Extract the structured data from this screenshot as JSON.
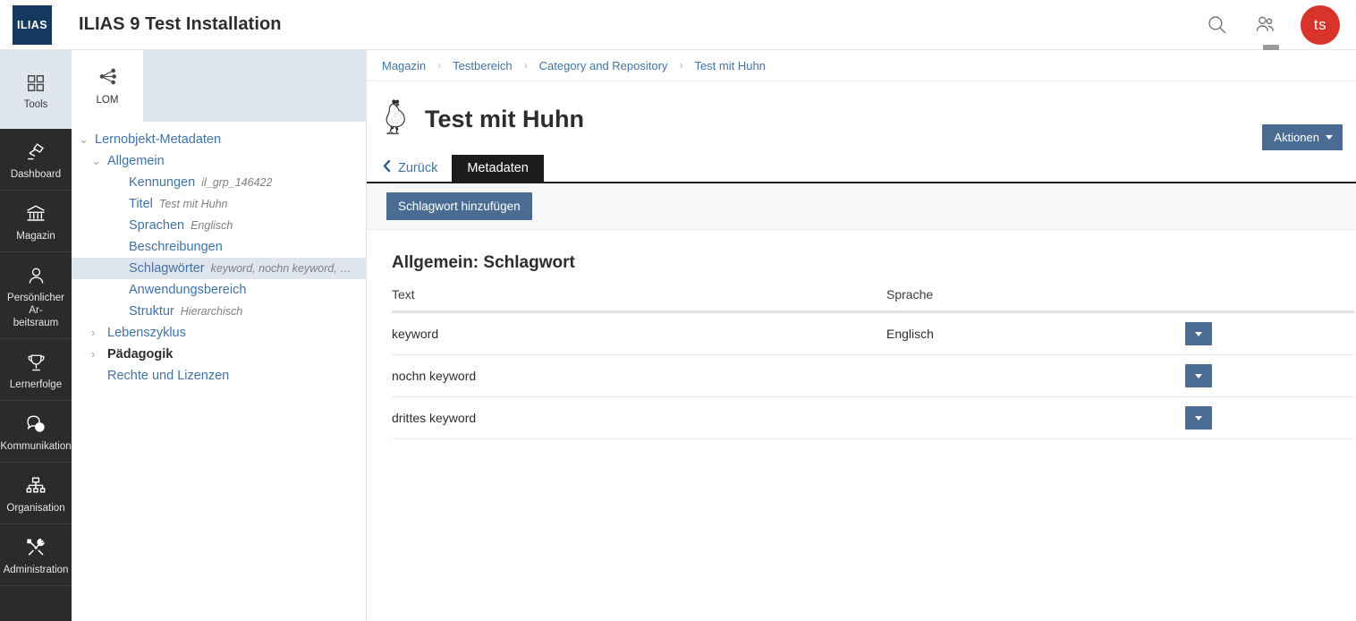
{
  "header": {
    "logo_text": "ILIAS",
    "install_title": "ILIAS 9 Test Installation",
    "search_icon": "search-icon",
    "users_icon": "users-icon",
    "avatar_initials": "ts"
  },
  "mainbar": {
    "items": [
      {
        "label": "Tools",
        "icon": "grid-icon",
        "active": true
      },
      {
        "label": "Dashboard",
        "icon": "desk-lamp-icon",
        "active": false
      },
      {
        "label": "Magazin",
        "icon": "bank-icon",
        "active": false
      },
      {
        "label": "Persönlicher Ar-\nbeitsraum",
        "icon": "person-icon",
        "active": false
      },
      {
        "label": "Lernerfolge",
        "icon": "trophy-icon",
        "active": false
      },
      {
        "label": "Kommunikation",
        "icon": "chat-icon",
        "active": false
      },
      {
        "label": "Organisation",
        "icon": "org-chart-icon",
        "active": false
      },
      {
        "label": "Administration",
        "icon": "tools-icon",
        "active": false
      }
    ]
  },
  "tool_panel": {
    "lom_label": "LOM",
    "lom_icon": "share-nodes-icon",
    "tree": [
      {
        "label": "Lernobjekt-Metadaten",
        "value": "",
        "level": 1,
        "chevron": "down",
        "selected": false,
        "bold": false
      },
      {
        "label": "Allgemein",
        "value": "",
        "level": 2,
        "chevron": "down",
        "selected": false,
        "bold": false
      },
      {
        "label": "Kennungen",
        "value": "il_grp_146422",
        "level": 3,
        "chevron": "none",
        "selected": false,
        "bold": false
      },
      {
        "label": "Titel",
        "value": "Test mit Huhn",
        "level": 3,
        "chevron": "none",
        "selected": false,
        "bold": false
      },
      {
        "label": "Sprachen",
        "value": "Englisch",
        "level": 3,
        "chevron": "none",
        "selected": false,
        "bold": false
      },
      {
        "label": "Beschreibungen",
        "value": "",
        "level": 3,
        "chevron": "none",
        "selected": false,
        "bold": false
      },
      {
        "label": "Schlagwörter",
        "value": "keyword, nochn keyword, drittes ke...",
        "level": 3,
        "chevron": "none",
        "selected": true,
        "bold": false
      },
      {
        "label": "Anwendungsbereich",
        "value": "",
        "level": 3,
        "chevron": "none",
        "selected": false,
        "bold": false
      },
      {
        "label": "Struktur",
        "value": "Hierarchisch",
        "level": 3,
        "chevron": "none",
        "selected": false,
        "bold": false
      },
      {
        "label": "Lebenszyklus",
        "value": "",
        "level": 2,
        "chevron": "right",
        "selected": false,
        "bold": false
      },
      {
        "label": "Pädagogik",
        "value": "",
        "level": 2,
        "chevron": "right",
        "selected": false,
        "bold": true
      },
      {
        "label": "Rechte und Lizenzen",
        "value": "",
        "level": 2,
        "chevron": "none",
        "selected": false,
        "bold": false
      }
    ]
  },
  "content": {
    "breadcrumb": [
      "Magazin",
      "Testbereich",
      "Category and Repository",
      "Test mit Huhn"
    ],
    "breadcrumb_separator": "›",
    "object_icon": "chicken-icon",
    "page_title": "Test mit Huhn",
    "actions_button": "Aktionen",
    "tabs": {
      "back_label": "Zurück",
      "back_icon": "chevron-left-icon",
      "active_tab": "Metadaten"
    },
    "toolbar": {
      "add_keyword_label": "Schlagwort hinzufügen"
    },
    "section_title": "Allgemein: Schlagwort",
    "table": {
      "columns": [
        "Text",
        "Sprache"
      ],
      "rows": [
        {
          "text": "keyword",
          "sprache": "Englisch"
        },
        {
          "text": "nochn keyword",
          "sprache": ""
        },
        {
          "text": "drittes keyword",
          "sprache": ""
        }
      ],
      "row_action_icon": "chevron-down-icon"
    }
  },
  "colors": {
    "brand_dark": "#15385e",
    "accent_blue": "#4a6c92",
    "link_blue": "#4273a5",
    "avatar_red": "#d9342b",
    "nav_dark": "#2b2b2b",
    "highlight": "#dfe6ee"
  }
}
